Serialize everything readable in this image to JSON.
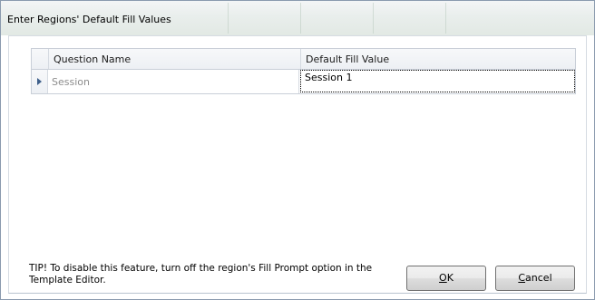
{
  "dialog": {
    "title": "Enter Regions' Default Fill Values"
  },
  "grid": {
    "columns": [
      "Question Name",
      "Default Fill Value"
    ],
    "rows": [
      {
        "question_name": "Session",
        "default_fill_value": "Session 1"
      }
    ]
  },
  "tip": {
    "line1": "TIP! To disable this feature, turn off the region's Fill Prompt option in the",
    "line2": "Template Editor."
  },
  "buttons": {
    "ok_mnemonic": "O",
    "ok_rest": "K",
    "cancel_mnemonic": "C",
    "cancel_rest": "ancel"
  },
  "colors": {
    "row_arrow": "#3e5f8a",
    "disabled_text": "#8c8c8c"
  }
}
